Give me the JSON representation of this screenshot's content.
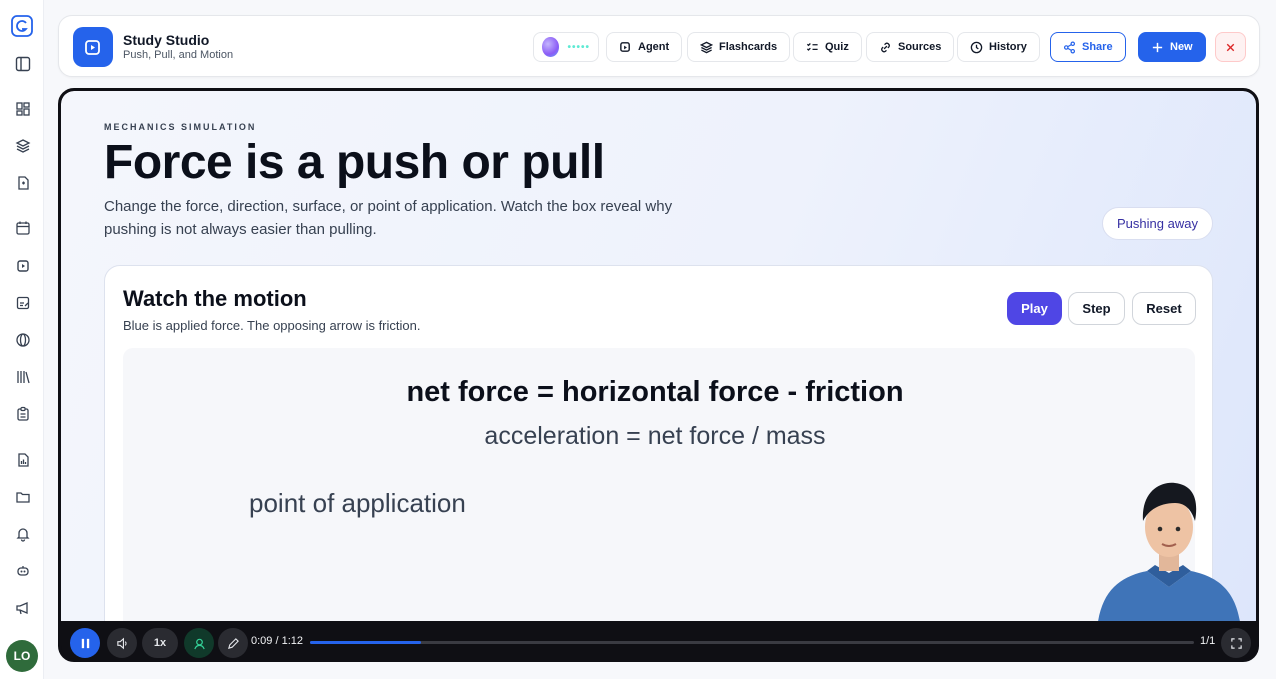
{
  "header": {
    "title": "Study Studio",
    "subtitle": "Push, Pull, and Motion",
    "nav": [
      {
        "label": "Agent",
        "icon": "agent-icon"
      },
      {
        "label": "Flashcards",
        "icon": "layers-icon"
      },
      {
        "label": "Quiz",
        "icon": "checklist-icon"
      },
      {
        "label": "Sources",
        "icon": "link-icon"
      },
      {
        "label": "History",
        "icon": "clock-icon"
      }
    ],
    "share_label": "Share",
    "new_label": "New",
    "orb_dots": "•••••"
  },
  "sidebar": {
    "user_initials": "LO",
    "icons": [
      "logo-icon",
      "panel-toggle-icon",
      "dashboard-icon",
      "layers-icon",
      "document-icon",
      "calendar-icon",
      "study-icon",
      "edit-note-icon",
      "globe-icon",
      "library-icon",
      "clipboard-icon",
      "report-icon",
      "folder-icon",
      "bell-icon",
      "bot-icon",
      "megaphone-icon"
    ]
  },
  "lesson": {
    "eyebrow": "MECHANICS SIMULATION",
    "headline": "Force is a push or pull",
    "lede": "Change the force, direction, surface, or point of application. Watch the box reveal why pushing is not always easier than pulling.",
    "status": "Pushing away"
  },
  "card": {
    "title": "Watch the motion",
    "subtitle": "Blue is applied force. The opposing arrow is friction.",
    "play_label": "Play",
    "step_label": "Step",
    "reset_label": "Reset"
  },
  "simulation": {
    "equation_net": "net force = horizontal force - friction",
    "equation_accel": "acceleration = net force / mass",
    "point_label": "point of application"
  },
  "player": {
    "speed": "1x",
    "time": "0:09 / 1:12",
    "progress": 0.125,
    "page": "1/1"
  },
  "colors": {
    "accent": "#2563eb",
    "play": "#4f46e5",
    "close": "#dc2626"
  }
}
